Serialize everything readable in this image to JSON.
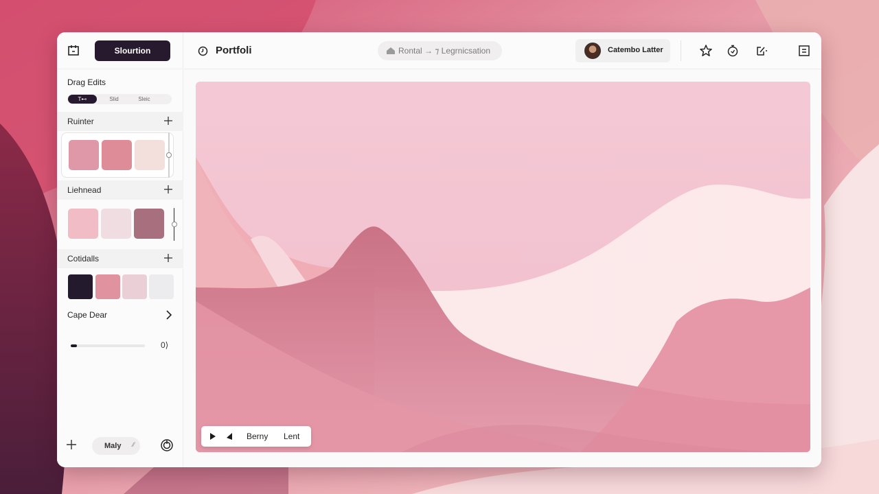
{
  "sidebar": {
    "primary_button": "Slourtion",
    "heading": "Drag Edits",
    "segments": [
      "T⊷",
      "Slid",
      "Sleic"
    ],
    "sections": [
      {
        "title": "Ruinter",
        "swatches": [
          "#de98a8",
          "#de8c98",
          "#f3dfdc"
        ],
        "slider_value": 0.5
      },
      {
        "title": "Liehnead",
        "swatches": [
          "#f1bcc6",
          "#f0dde1",
          "#a8707f"
        ],
        "slider_value": 0.5
      },
      {
        "title": "Cotidalls",
        "swatches": [
          "#231a2d",
          "#e0939f",
          "#ebcfd6",
          "#ecebee"
        ]
      }
    ],
    "cape": {
      "label": "Cape Dear",
      "value_text": "0⟩",
      "slider_value": 0.08
    },
    "footer": {
      "pill_label": "Maly",
      "pill_arrow": "⁄⁄"
    }
  },
  "topbar": {
    "title": "Portfoli",
    "breadcrumb": "Rontal → ⁊ Legrnicsation",
    "user_name": "Catembo Latter"
  },
  "canvas": {
    "toolbar_labels": [
      "Berny",
      "Lent"
    ]
  },
  "colors": {
    "accent_dark": "#271a2e",
    "canvas_bg": "#f4c8d4"
  }
}
